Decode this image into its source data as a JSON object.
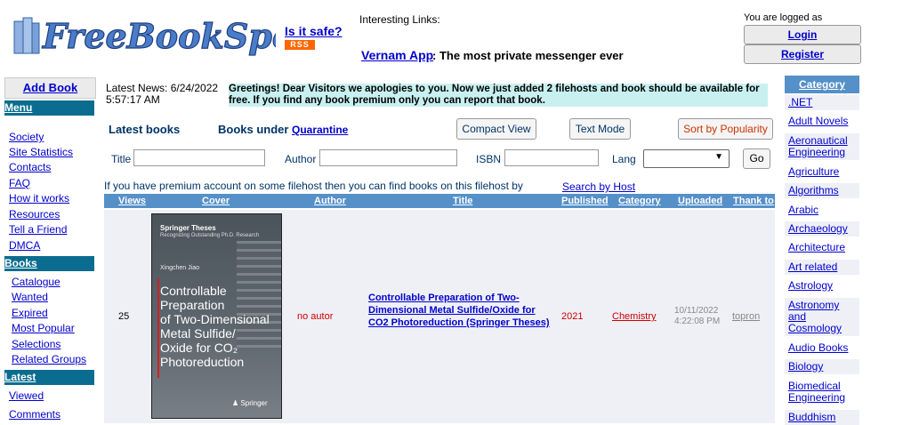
{
  "header": {
    "logo_text": "FreeBookSpot",
    "is_it_safe": "Is it safe?",
    "rss": "RSS",
    "interesting_links": "Interesting Links:",
    "vernam_link": "Vernam App",
    "vernam_desc": ": The most private messenger ever",
    "logged_as": "You are logged as",
    "login": "Login",
    "register": "Register"
  },
  "left": {
    "add_book": "Add Book",
    "menu_head": "Menu",
    "menu": [
      "Society",
      "Site Statistics",
      "Contacts",
      "FAQ",
      "How it works",
      "Resources",
      "Tell a Friend",
      "DMCA"
    ],
    "books_head": "Books",
    "books": [
      "Catalogue",
      "Wanted",
      "Expired",
      "Most Popular",
      "Selections",
      "Related Groups"
    ],
    "latest_head": "Latest",
    "latest": [
      "Viewed",
      "Comments"
    ]
  },
  "news": {
    "date": "Latest News: 6/24/2022 5:57:17 AM",
    "message": "Greetings! Dear Visitors we apologies to you. Now we just added 2 filehosts and book should be available for free. If you find any book premium only you can report that book."
  },
  "toolbar": {
    "latest_books": "Latest books",
    "books_under": "Books under",
    "quarantine": "Quarantine",
    "compact_view": "Compact View",
    "text_mode": "Text Mode",
    "sort": "Sort by Popularity"
  },
  "search": {
    "title_label": "Title",
    "author_label": "Author",
    "isbn_label": "ISBN",
    "lang_label": "Lang",
    "go": "Go",
    "premium_note": "If you have premium account on some filehost then you can find books on this filehost by",
    "search_by_host": "Search by Host"
  },
  "table": {
    "headers": [
      "Views",
      "Cover",
      "Author",
      "Title",
      "Published",
      "Category",
      "Uploaded",
      "Thank to"
    ],
    "row": {
      "views": "25",
      "author": "no autor",
      "title": "Controllable Preparation of Two-Dimensional Metal Sulfide/Oxide for CO2 Photoreduction (Springer Theses)",
      "published": "2021",
      "category": "Chemistry",
      "uploaded_date": "10/11/2022",
      "uploaded_time": "4:22:08 PM",
      "thank_to": "topron"
    },
    "cover": {
      "series": "Springer Theses",
      "series_sub": "Recognizing Outstanding Ph.D. Research",
      "author": "Xingchen Jiao",
      "title_lines": [
        "Controllable",
        "Preparation",
        "of Two-Dimensional",
        "Metal Sulfide/",
        "Oxide for CO₂",
        "Photoreduction"
      ],
      "publisher": "Springer"
    }
  },
  "right": {
    "category_head": "Category",
    "categories": [
      ".NET",
      "Adult Novels",
      "Aeronautical Engineering",
      "Agriculture",
      "Algorithms",
      "Arabic",
      "Archaeology",
      "Architecture",
      "Art related",
      "Astrology",
      "Astronomy and Cosmology",
      "Audio Books",
      "Biology",
      "Biomedical Engineering",
      "Buddhism"
    ]
  },
  "colors": {
    "header_blue": "#5590c8",
    "sidebar_teal": "#0a6d8f",
    "news_bg": "#c8f0f0",
    "link": "#0000cc",
    "accent_red": "#cc3300"
  }
}
